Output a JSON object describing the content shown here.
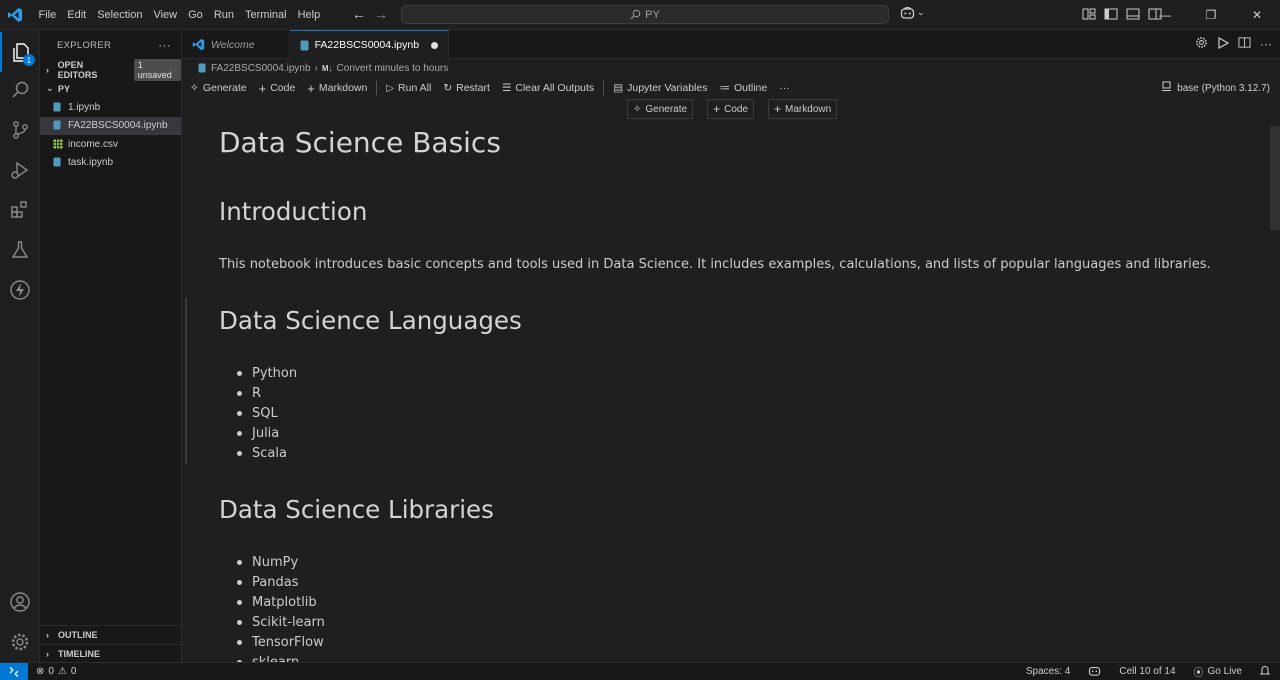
{
  "app": {
    "logo_icon": "vscode-logo-icon",
    "accent": "#0078d4"
  },
  "menu": [
    "File",
    "Edit",
    "Selection",
    "View",
    "Go",
    "Run",
    "Terminal",
    "Help"
  ],
  "command_center": {
    "text": "PY"
  },
  "explorer": {
    "title": "EXPLORER",
    "open_editors": {
      "label": "OPEN EDITORS",
      "badge": "1 unsaved"
    },
    "folder": "PY",
    "files": [
      {
        "name": "1.ipynb",
        "icon": "notebook-file-icon",
        "selected": false
      },
      {
        "name": "FA22BSCS0004.ipynb",
        "icon": "notebook-file-icon",
        "selected": true
      },
      {
        "name": "income.csv",
        "icon": "csv-file-icon",
        "selected": false
      },
      {
        "name": "task.ipynb",
        "icon": "notebook-file-icon",
        "selected": false
      }
    ],
    "outline": "OUTLINE",
    "timeline": "TIMELINE"
  },
  "activity": {
    "explorer_badge": "1"
  },
  "tabs": [
    {
      "label": "Welcome",
      "active": false
    },
    {
      "label": "FA22BSCS0004.ipynb",
      "active": true,
      "dirty": true
    }
  ],
  "breadcrumb": {
    "file": "FA22BSCS0004.ipynb",
    "cell_marker": "M↓",
    "cell": "Convert minutes to hours"
  },
  "toolbar": {
    "generate": "Generate",
    "code": "Code",
    "markdown": "Markdown",
    "run_all": "Run All",
    "restart": "Restart",
    "clear_outputs": "Clear All Outputs",
    "variables": "Jupyter Variables",
    "outline": "Outline",
    "more": "···",
    "kernel": "base (Python 3.12.7)"
  },
  "insert": {
    "generate": "Generate",
    "code": "Code",
    "markdown": "Markdown"
  },
  "notebook": {
    "title": "Data Science Basics",
    "intro_heading": "Introduction",
    "intro_text": "This notebook introduces basic concepts and tools used in Data Science. It includes examples, calculations, and lists of popular languages and libraries.",
    "languages_heading": "Data Science Languages",
    "languages": [
      "Python",
      "R",
      "SQL",
      "Julia",
      "Scala"
    ],
    "libraries_heading": "Data Science Libraries",
    "libraries": [
      "NumPy",
      "Pandas",
      "Matplotlib",
      "Scikit-learn",
      "TensorFlow",
      "sklearn"
    ]
  },
  "status": {
    "errors": "0",
    "warnings": "0",
    "spaces": "Spaces: 4",
    "cell": "Cell 10 of 14",
    "golive": "Go Live"
  }
}
